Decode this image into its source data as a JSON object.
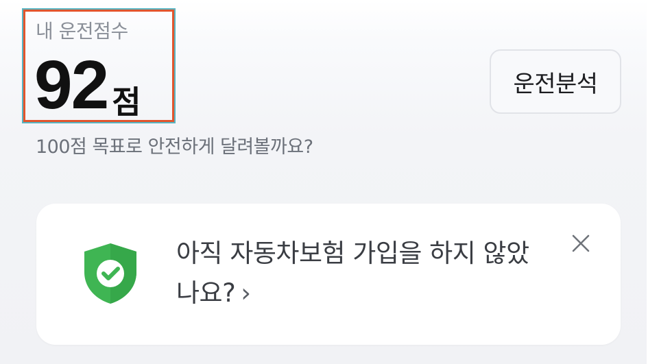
{
  "score": {
    "label": "내 운전점수",
    "value": "92",
    "unit": "점",
    "subtitle": "100점 목표로 안전하게 달려볼까요?"
  },
  "actions": {
    "analysis_label": "운전분석"
  },
  "promo": {
    "message": "아직 자동차보험 가입을 하지 않았나요?",
    "arrow": "›",
    "shield_icon": "shield-check-icon",
    "close_icon": "close-icon"
  },
  "colors": {
    "highlight_border": "#e2552d",
    "shield_green": "#3fb553",
    "shield_green_dark": "#2e9e42"
  }
}
